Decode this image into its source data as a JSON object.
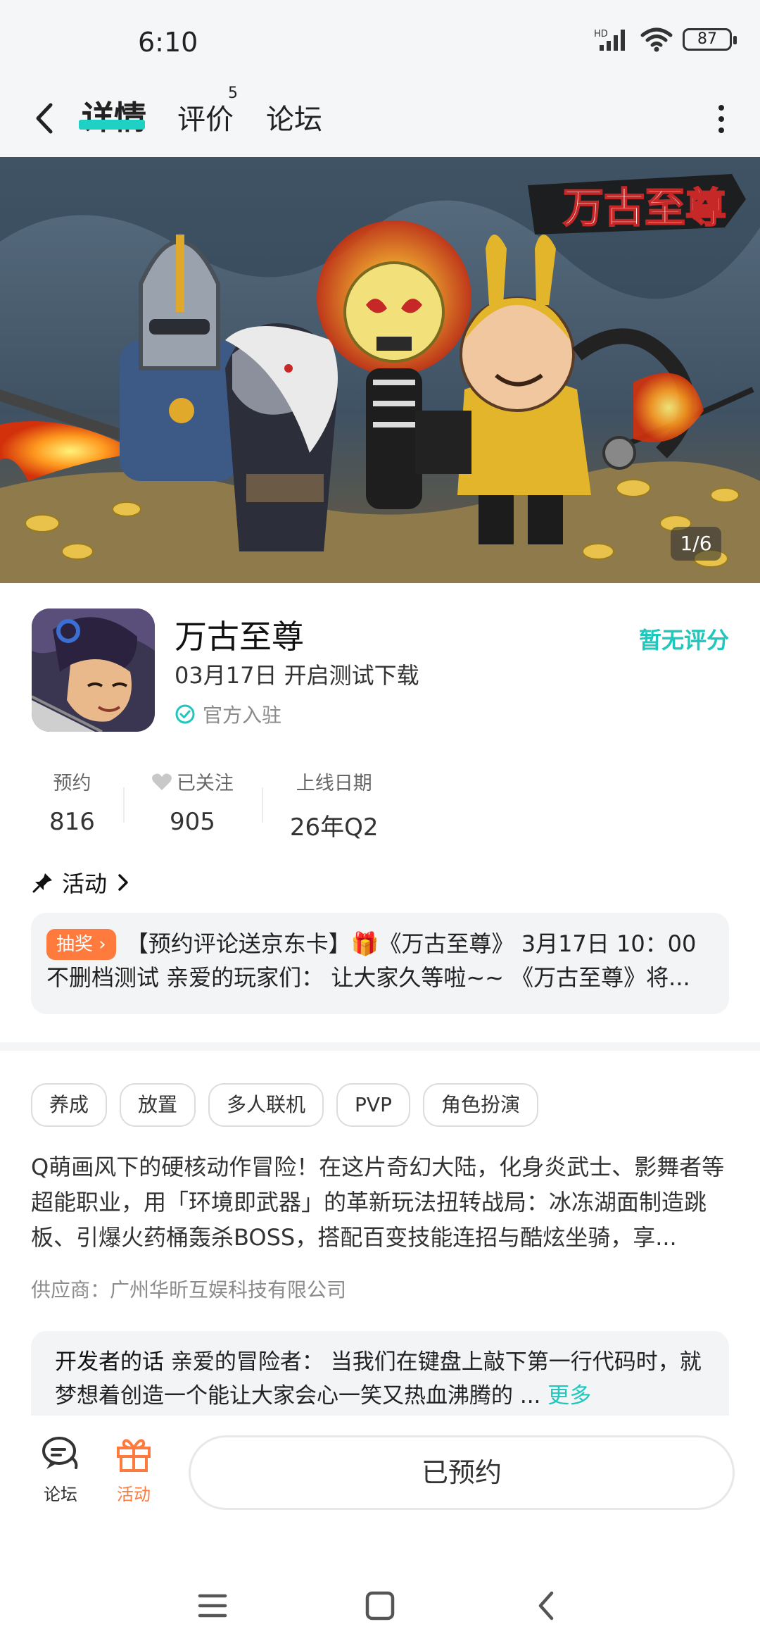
{
  "status_bar": {
    "time": "6:10",
    "network": "HD",
    "battery": "87"
  },
  "nav": {
    "tabs": [
      {
        "label": "详情",
        "active": true
      },
      {
        "label": "评价",
        "badge": "5"
      },
      {
        "label": "论坛"
      }
    ]
  },
  "banner": {
    "counter": "1/6",
    "logo_text": "万古至尊"
  },
  "app": {
    "name": "万古至尊",
    "date_line": "03月17日 开启测试下载",
    "official": "官方入驻",
    "rating": "暂无评分"
  },
  "stats": [
    {
      "label": "预约",
      "value": "816"
    },
    {
      "label": "已关注",
      "value": "905"
    },
    {
      "label": "上线日期",
      "value": "26年Q2"
    }
  ],
  "activity": {
    "title": "活动",
    "badge": "抽奖",
    "line1": "【预约评论送京东卡】🎁《万古至尊》 3月17日 10：00",
    "line2": "不删档测试 亲爱的玩家们： 让大家久等啦~~ 《万古至尊》将..."
  },
  "tags": [
    "养成",
    "放置",
    "多人联机",
    "PVP",
    "角色扮演"
  ],
  "description": "Q萌画风下的硬核动作冒险！在这片奇幻大陆，化身炎武士、影舞者等超能职业，用「环境即武器」的革新玩法扭转战局：冰冻湖面制造跳板、引爆火药桶轰杀BOSS，搭配百变技能连招与酷炫坐骑，享...",
  "supplier": "供应商：广州华昕互娱科技有限公司",
  "developer": {
    "title": "开发者的话",
    "text": "亲爱的冒险者： 当我们在键盘上敲下第一行代码时，就梦想着创造一个能让大家会心一笑又热血沸腾的 ...",
    "more": "更多"
  },
  "bottom_bar": {
    "forum_label": "论坛",
    "activity_label": "活动",
    "reserve_label": "已预约"
  },
  "colors": {
    "accent": "#1fc7bd",
    "orange": "#ff7a3d"
  },
  "icons": [
    "back-icon",
    "more-vertical-icon",
    "verified-icon",
    "heart-icon",
    "pin-icon",
    "chevron-right-icon",
    "forum-icon",
    "gift-icon",
    "menu-icon",
    "home-icon",
    "nav-back-icon"
  ]
}
